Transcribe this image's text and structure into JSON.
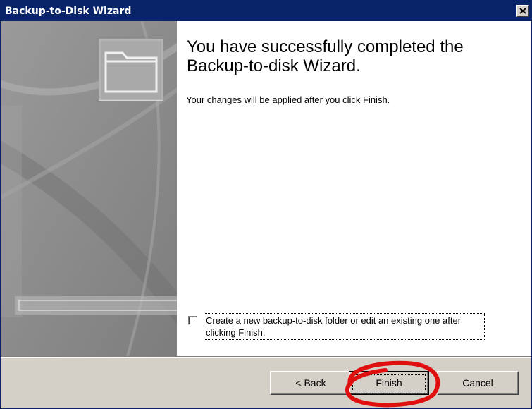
{
  "window": {
    "title": "Backup-to-Disk Wizard",
    "close_icon": "close-icon",
    "title_bar_color": "#0a246a"
  },
  "sidebar": {
    "illustration_icon": "folder-icon"
  },
  "main": {
    "heading": "You have successfully completed the Backup-to-disk Wizard.",
    "message": "Your changes will be applied after you click Finish.",
    "option": {
      "label": "Create a new backup-to-disk folder or edit an existing one after clicking Finish.",
      "checked": false
    }
  },
  "buttons": {
    "back": "< Back",
    "finish": "Finish",
    "cancel": "Cancel"
  },
  "annotation": {
    "shape": "red-ellipse-highlight",
    "color": "#e01010"
  }
}
